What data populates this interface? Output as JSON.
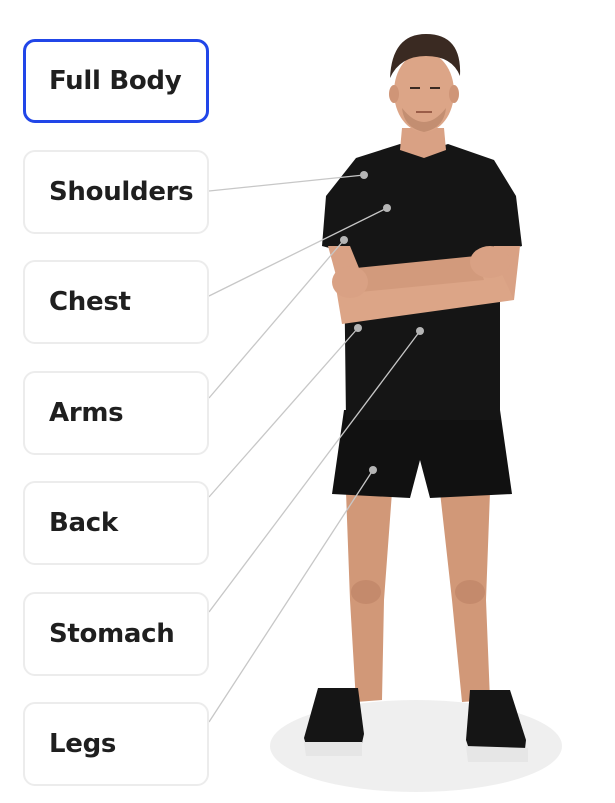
{
  "body_parts": [
    {
      "label": "Full Body",
      "selected": true
    },
    {
      "label": "Shoulders",
      "selected": false
    },
    {
      "label": "Chest",
      "selected": false
    },
    {
      "label": "Arms",
      "selected": false
    },
    {
      "label": "Back",
      "selected": false
    },
    {
      "label": "Stomach",
      "selected": false
    },
    {
      "label": "Legs",
      "selected": false
    }
  ],
  "colors": {
    "selected_border": "#2146e8",
    "button_border": "#ececec",
    "text": "#1f1f1f",
    "connector_line": "#c7c7c7",
    "marker_dot": "#b5b5b5",
    "shirt": "#151515",
    "skin": "#d9a184"
  },
  "figure": {
    "icon": "male-athlete-figure"
  }
}
